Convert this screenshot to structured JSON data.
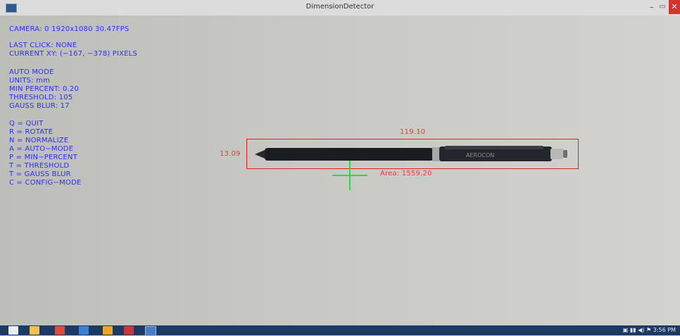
{
  "window": {
    "title": "DimensionDetector"
  },
  "overlay_left": [
    "CAMERA: 0 1920x1080 30.47FPS",
    "LAST CLICK: NONE",
    "CURRENT XY: (−167, −378) PIXELS",
    "AUTO MODE",
    "UNITS: mm",
    "MIN PERCENT: 0.20",
    "THRESHOLD: 105",
    "GAUSS BLUR: 17",
    "Q = QUIT",
    "R = ROTATE",
    "N = NORMALIZE",
    "A = AUTO−MODE",
    "P = MIN−PERCENT",
    "T = THRESHOLD",
    "T = GAUSS BLUR",
    "C = CONFIG−MODE"
  ],
  "measurements": {
    "width_label": "119.10",
    "height_label": "13.09",
    "area_label": "Area: 1559.20"
  },
  "pen": {
    "brand": "AEROCON"
  },
  "colors": {
    "overlay_text": "#2b2fff",
    "measure": "#f03a3a",
    "crosshair": "#22e034",
    "taskbar": "#1d3a63"
  },
  "taskbar": {
    "clock": "3:56 PM",
    "tray_icons": [
      "network-icon",
      "signal-icon",
      "volume-icon",
      "flag-icon"
    ],
    "apps": [
      "start-icon",
      "explorer-icon",
      "app-icon",
      "media-icon",
      "chrome-icon",
      "app2-icon",
      "dimensiondetector-icon"
    ]
  }
}
